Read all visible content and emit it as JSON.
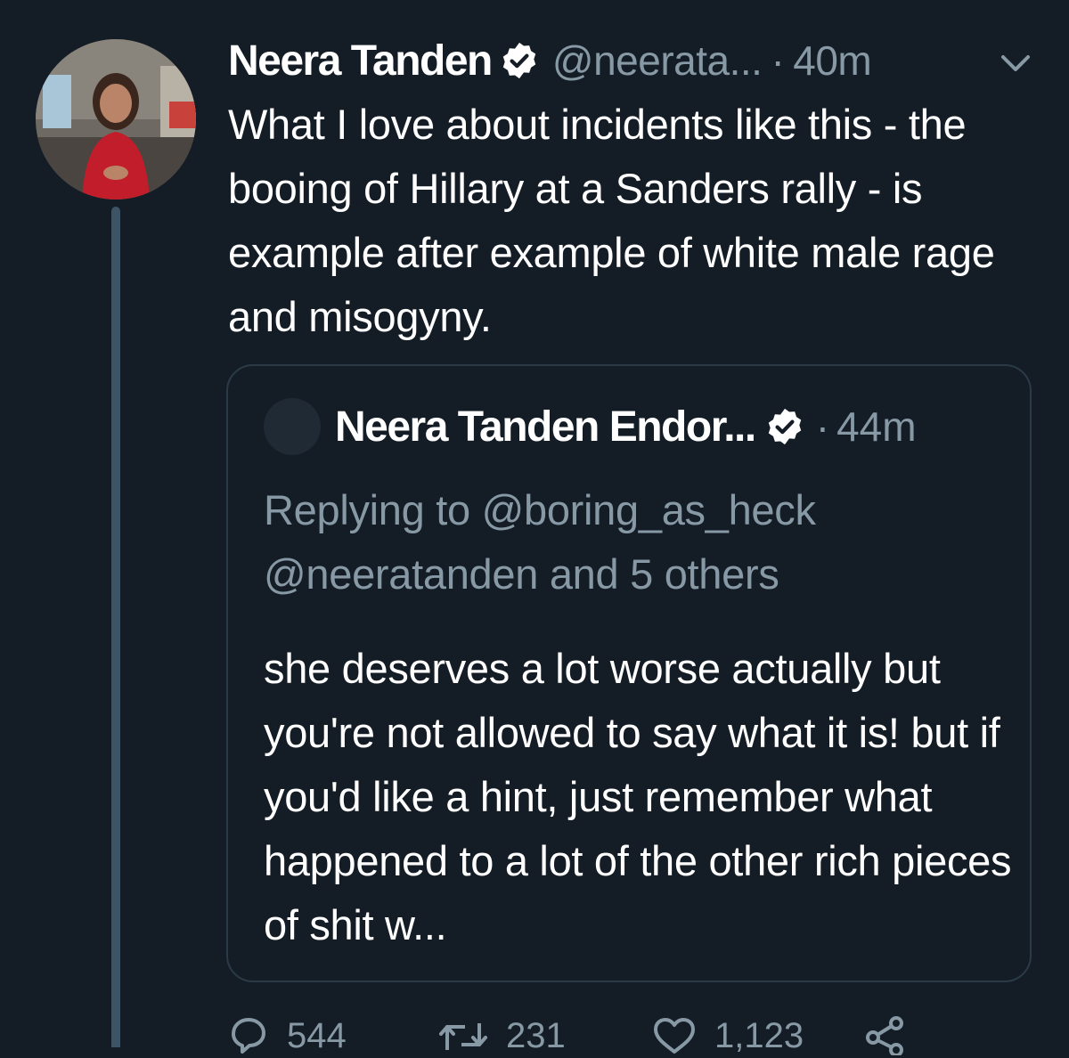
{
  "tweet": {
    "author_name": "Neera Tanden",
    "handle": "@neerata...",
    "separator": "·",
    "time": "40m",
    "text": "What I love about incidents like this - the booing of Hillary at a Sanders rally - is example after example of white male rage and misogyny."
  },
  "quoted_tweet": {
    "author_name": "Neera Tanden Endor...",
    "separator": "·",
    "time": "44m",
    "replying_to": "Replying to @boring_as_heck @neeratanden and 5 others",
    "text": "she deserves a lot worse actually but you're not allowed to say what it is! but if you'd like a hint, just remember what happened to a lot of the other rich pieces of shit w..."
  },
  "actions": {
    "reply_count": "544",
    "retweet_count": "231",
    "like_count": "1,123"
  },
  "icons": {
    "verified": "verified-badge-icon",
    "caret": "chevron-down-icon",
    "reply": "reply-icon",
    "retweet": "retweet-icon",
    "like": "heart-icon",
    "share": "share-icon"
  },
  "colors": {
    "background": "#141d26",
    "secondary_text": "#8899a6",
    "thread_line": "#3d5466",
    "quote_border": "#2b3a47"
  }
}
